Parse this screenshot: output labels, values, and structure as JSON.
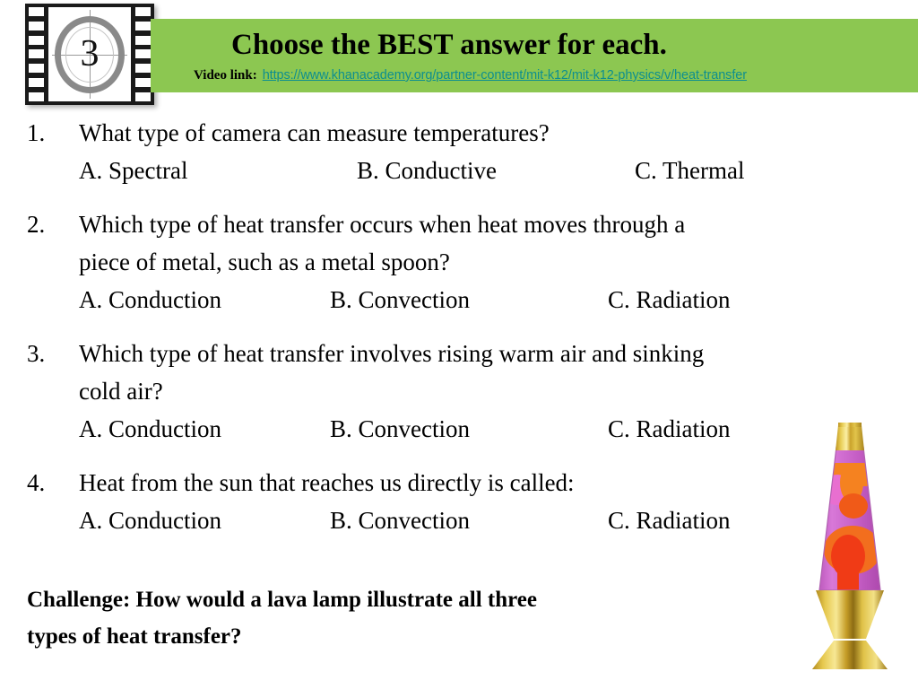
{
  "header": {
    "title": "Choose the BEST answer for each.",
    "video_link_label": "Video link:",
    "video_link_url": "https://www.khanacademy.org/partner-content/mit-k12/mit-k12-physics/v/heat-transfer",
    "band_color": "#8CC751",
    "link_color": "#0E8F8F",
    "film_icon_number": "3"
  },
  "questions": [
    {
      "number": "1.",
      "text": "What type of camera can measure temperatures?",
      "text_line2": "",
      "options": [
        {
          "label": "A.",
          "text": "Spectral"
        },
        {
          "label": "B.",
          "text": "Conductive"
        },
        {
          "label": "C.",
          "text": "Thermal"
        }
      ]
    },
    {
      "number": "2.",
      "text": "Which type of heat transfer occurs when heat moves through a",
      "text_line2": "piece of metal, such as a metal spoon?",
      "options": [
        {
          "label": "A.",
          "text": "Conduction"
        },
        {
          "label": "B.",
          "text": "Convection"
        },
        {
          "label": "C.",
          "text": "Radiation"
        }
      ]
    },
    {
      "number": "3.",
      "text": "Which type of heat transfer involves rising warm air and sinking",
      "text_line2": "cold air?",
      "options": [
        {
          "label": "A.",
          "text": "Conduction"
        },
        {
          "label": "B.",
          "text": "Convection"
        },
        {
          "label": "C.",
          "text": "Radiation"
        }
      ]
    },
    {
      "number": "4.",
      "text": "Heat from the sun that reaches us directly is called:",
      "text_line2": "",
      "options": [
        {
          "label": "A.",
          "text": "Conduction"
        },
        {
          "label": "B.",
          "text": "Convection"
        },
        {
          "label": "C.",
          "text": "Radiation"
        }
      ]
    }
  ],
  "challenge": {
    "line1": "Challenge: How would a lava lamp illustrate all three",
    "line2": "types of heat transfer?"
  },
  "lava_lamp": {
    "cap_color": "#D4AF37",
    "base_color": "#D9B739",
    "liquid_color": "#C964C9",
    "blob_color_top": "#F58220",
    "blob_color_bottom": "#F03B16"
  }
}
